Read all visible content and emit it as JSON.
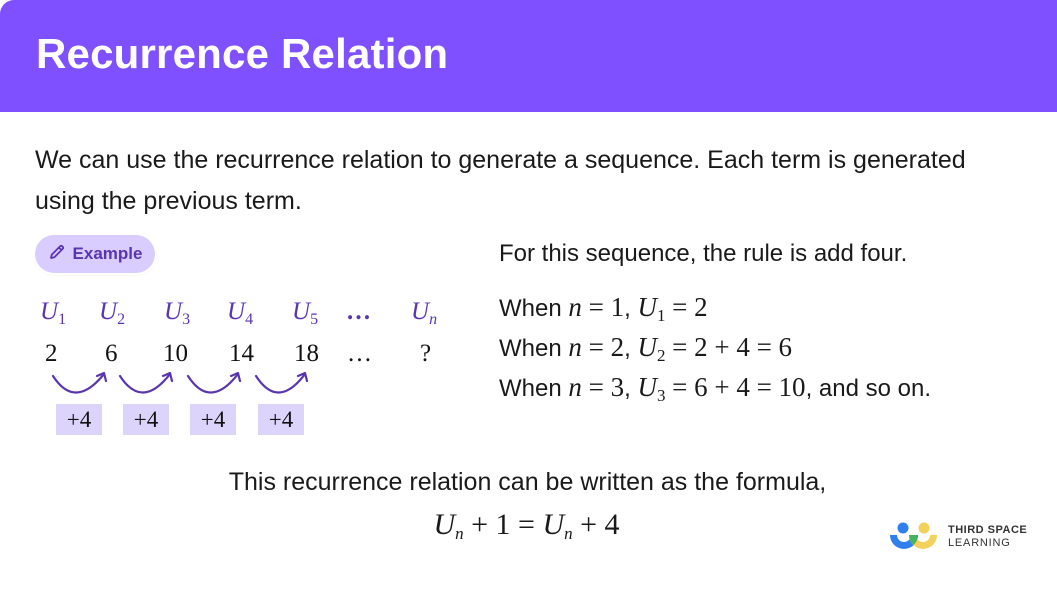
{
  "header": {
    "title": "Recurrence Relation"
  },
  "intro": {
    "text": "We can use the recurrence relation to generate a sequence. Each term is generated using the previous term."
  },
  "badge": {
    "label": "Example",
    "icon": "pencil-icon"
  },
  "sequence": {
    "labels": [
      {
        "base": "U",
        "sub": "1"
      },
      {
        "base": "U",
        "sub": "2"
      },
      {
        "base": "U",
        "sub": "3"
      },
      {
        "base": "U",
        "sub": "4"
      },
      {
        "base": "U",
        "sub": "5"
      },
      {
        "base": "…",
        "sub": ""
      },
      {
        "base": "U",
        "sub": "n"
      }
    ],
    "values": [
      "2",
      "6",
      "10",
      "14",
      "18",
      "…",
      "?"
    ],
    "steps": [
      "+4",
      "+4",
      "+4",
      "+4"
    ]
  },
  "explanation": {
    "rule": "For this sequence, the rule is add four.",
    "lines": [
      {
        "prefix": "When",
        "n": "1",
        "u_sub": "1",
        "rhs": "= 2",
        "suffix": ""
      },
      {
        "prefix": "When",
        "n": "2",
        "u_sub": "2",
        "rhs": "= 2 + 4 = 6",
        "suffix": ""
      },
      {
        "prefix": "When",
        "n": "3",
        "u_sub": "3",
        "rhs": "= 6 + 4 = 10",
        "suffix": ", and so on."
      }
    ]
  },
  "footer": {
    "text": "This recurrence relation can be written as the formula,",
    "formula": {
      "lhs_base": "U",
      "lhs_sub": "n",
      "lhs_rest": " + 1 = ",
      "rhs_base": "U",
      "rhs_sub": "n",
      "rhs_rest": " + 4"
    }
  },
  "logo": {
    "line1": "THIRD SPACE",
    "line2": "LEARNING"
  },
  "colors": {
    "header_bg": "#7f50ff",
    "accent": "#5a35b0",
    "badge_bg": "#d9ccff",
    "step_box_bg": "#ddd4fb"
  }
}
